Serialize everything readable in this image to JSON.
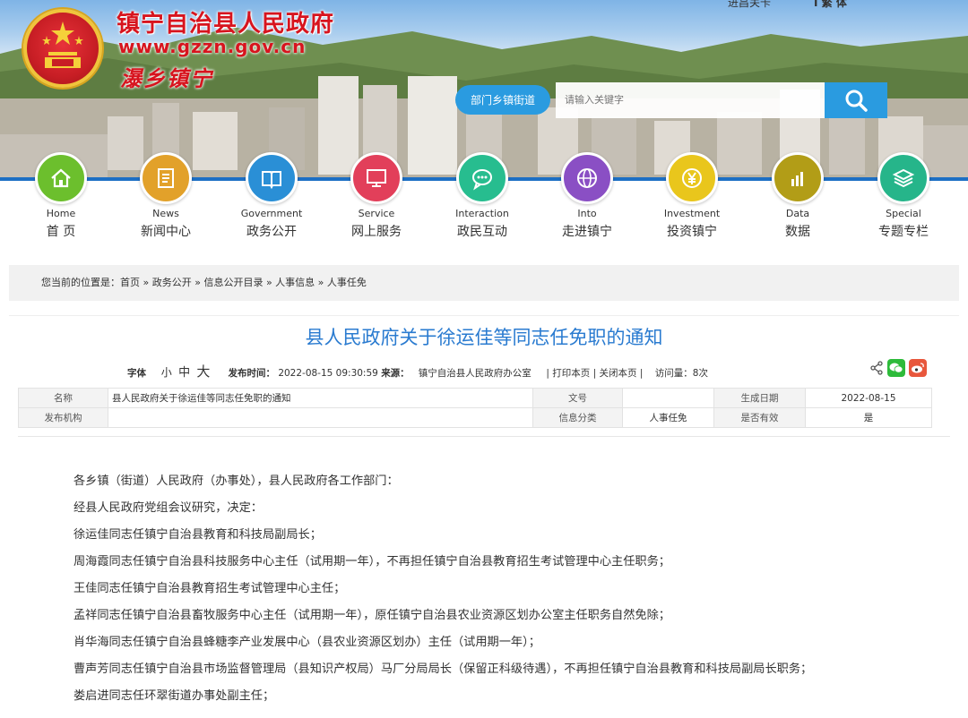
{
  "header": {
    "site_title": "镇宁自治县人民政府",
    "site_url": "www.gzzn.gov.cn",
    "slogan": "瀑乡镇宁",
    "top_link_1": "进昌关卡",
    "top_link_2": "I 繁 体"
  },
  "search": {
    "dept_button": "部门乡镇街道",
    "placeholder": "请输入关键字"
  },
  "nav": {
    "items": [
      {
        "en": "Home",
        "cn": "首 页",
        "color": "#6cbf2d",
        "icon": "home-icon"
      },
      {
        "en": "News",
        "cn": "新闻中心",
        "color": "#e2a12a",
        "icon": "news-icon"
      },
      {
        "en": "Government",
        "cn": "政务公开",
        "color": "#2a8fd6",
        "icon": "book-icon"
      },
      {
        "en": "Service",
        "cn": "网上服务",
        "color": "#e23f5a",
        "icon": "monitor-icon"
      },
      {
        "en": "Interaction",
        "cn": "政民互动",
        "color": "#27bd8f",
        "icon": "chat-icon"
      },
      {
        "en": "Into",
        "cn": "走进镇宁",
        "color": "#8a4fc4",
        "icon": "globe-icon"
      },
      {
        "en": "Investment",
        "cn": "投资镇宁",
        "color": "#e9c61c",
        "icon": "yen-icon"
      },
      {
        "en": "Data",
        "cn": "数据",
        "color": "#b29d17",
        "icon": "bar-chart-icon"
      },
      {
        "en": "Special",
        "cn": "专题专栏",
        "color": "#26b58a",
        "icon": "layers-icon"
      }
    ]
  },
  "breadcrumb": {
    "text": "您当前的位置是：首页 » 政务公开 » 信息公开目录 » 人事信息 » 人事任免"
  },
  "article": {
    "title": "县人民政府关于徐运佳等同志任免职的通知",
    "font_label": "字体",
    "font_small": "小",
    "font_medium": "中",
    "font_large": "大",
    "publish_label": "发布时间：",
    "publish_time": "2022-08-15 09:30:59",
    "source_label": "来源：",
    "source": "镇宁自治县人民政府办公室",
    "print": "| 打印本页 |",
    "close": "关闭本页 |",
    "visits": "访问量：8次"
  },
  "info_table": {
    "name_label": "名称",
    "name_value": "县人民政府关于徐运佳等同志任免职的通知",
    "doc_no_label": "文号",
    "doc_no_value": "",
    "date_label": "生成日期",
    "date_value": "2022-08-15",
    "publisher_label": "发布机构",
    "publisher_value": "",
    "category_label": "信息分类",
    "category_value": "人事任免",
    "valid_label": "是否有效",
    "valid_value": "是"
  },
  "body": {
    "lines": [
      "各乡镇（街道）人民政府（办事处），县人民政府各工作部门：",
      "经县人民政府党组会议研究，决定：",
      "徐运佳同志任镇宁自治县教育和科技局副局长；",
      "周海霞同志任镇宁自治县科技服务中心主任（试用期一年），不再担任镇宁自治县教育招生考试管理中心主任职务；",
      "王佳同志任镇宁自治县教育招生考试管理中心主任；",
      "孟祥同志任镇宁自治县畜牧服务中心主任（试用期一年），原任镇宁自治县农业资源区划办公室主任职务自然免除；",
      "肖华海同志任镇宁自治县蜂糖李产业发展中心（县农业资源区划办）主任（试用期一年）；",
      "曹声芳同志任镇宁自治县市场监督管理局（县知识产权局）马厂分局局长（保留正科级待遇），不再担任镇宁自治县教育和科技局副局长职务；",
      "娄启进同志任环翠街道办事处副主任；"
    ]
  },
  "colors": {
    "accent": "#2a9be0",
    "title_red": "#d7141e",
    "article_title": "#2a7bd0"
  }
}
